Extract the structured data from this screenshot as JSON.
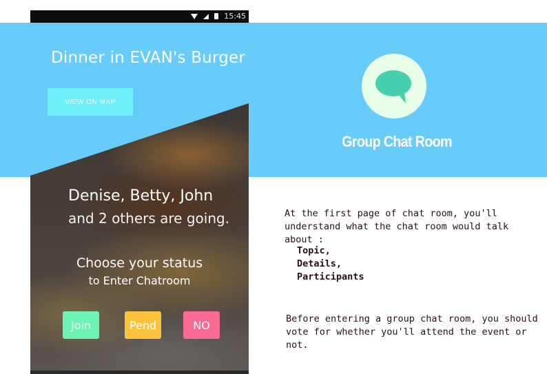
{
  "phone": {
    "status_bar": {
      "time": "15:45",
      "icons": [
        "wifi-icon",
        "signal-icon",
        "battery-icon"
      ]
    },
    "event_title": "Dinner in EVAN's Burger",
    "map_button_label": "VIEW ON MAP",
    "going_names": "Denise, Betty, John",
    "going_others": "and 2 others are going.",
    "status_prompt": "Choose your status",
    "status_subprompt": "to Enter Chatroom",
    "vote_buttons": [
      {
        "label": "Join",
        "color": "#6ef3b6"
      },
      {
        "label": "Pend",
        "color": "#fcc43c"
      },
      {
        "label": "NO",
        "color": "#fb6a92"
      }
    ]
  },
  "feature": {
    "icon": "chat-bubble-icon",
    "title": "Group Chat Room",
    "intro": "At the first page of chat room, you'll understand what the chat room would talk about :",
    "topics": [
      "Topic,",
      "Details,",
      "Participants"
    ],
    "vote_note": "Before entering a group chat room, you should vote for whether you'll attend the event or not."
  },
  "colors": {
    "band": "#68ccfa",
    "bubble": "#46d0ad",
    "circle": "#e8fde7"
  }
}
